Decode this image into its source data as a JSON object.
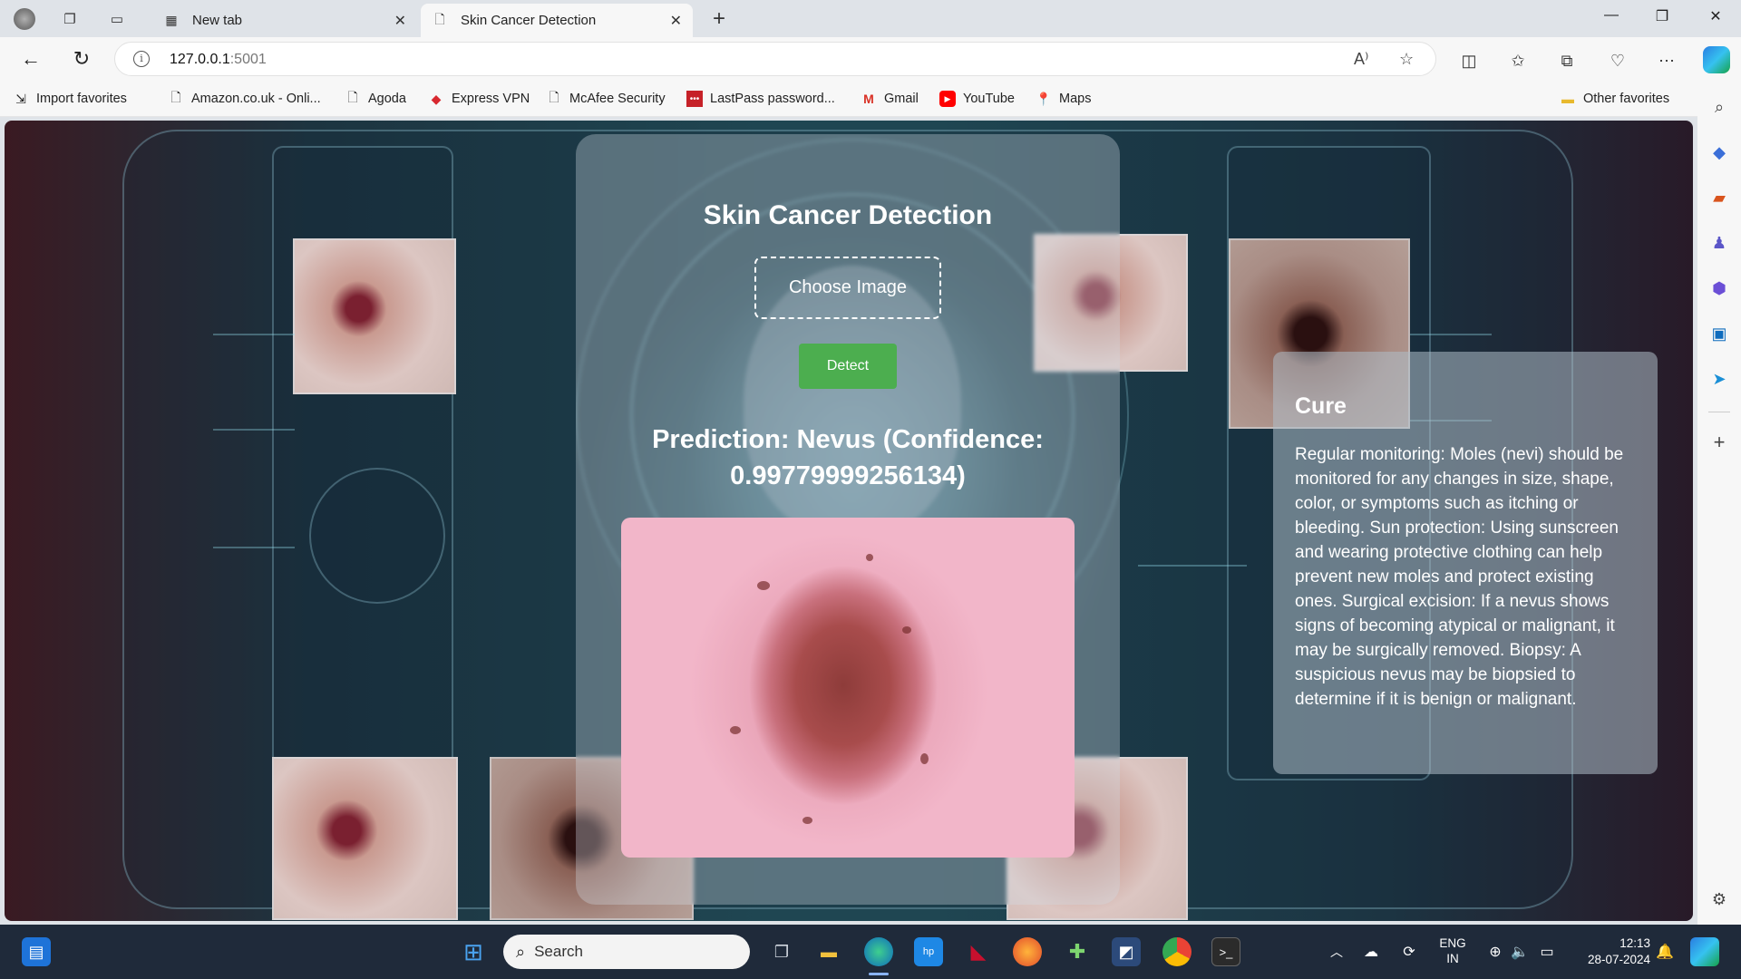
{
  "browser": {
    "tabs": [
      {
        "label": "New tab",
        "active": false
      },
      {
        "label": "Skin Cancer Detection",
        "active": true
      }
    ],
    "url_host": "127.0.0.1",
    "url_port": ":5001",
    "favorites": [
      {
        "label": "Import favorites",
        "icon": "import-icon"
      },
      {
        "label": "Amazon.co.uk - Onli...",
        "icon": "page-icon"
      },
      {
        "label": "Agoda",
        "icon": "page-icon"
      },
      {
        "label": "Express VPN",
        "icon": "expressvpn-icon"
      },
      {
        "label": "McAfee Security",
        "icon": "page-icon"
      },
      {
        "label": "LastPass password...",
        "icon": "lastpass-icon"
      },
      {
        "label": "Gmail",
        "icon": "gmail-icon"
      },
      {
        "label": "YouTube",
        "icon": "youtube-icon"
      },
      {
        "label": "Maps",
        "icon": "maps-icon"
      }
    ],
    "other_favorites": "Other favorites"
  },
  "page": {
    "title": "Skin Cancer Detection",
    "choose_label": "Choose Image",
    "detect_label": "Detect",
    "prediction_line1": "Prediction: Nevus (Confidence:",
    "prediction_line2": "0.99779999256134)",
    "cure": {
      "heading": "Cure",
      "body": "Regular monitoring: Moles (nevi) should be monitored for any changes in size, shape, color, or symptoms such as itching or bleeding. Sun protection: Using sunscreen and wearing protective clothing can help prevent new moles and protect existing ones. Surgical excision: If a nevus shows signs of becoming atypical or malignant, it may be surgically removed. Biopsy: A suspicious nevus may be biopsied to determine if it is benign or malignant."
    }
  },
  "taskbar": {
    "search_label": "Search",
    "lang_line1": "ENG",
    "lang_line2": "IN",
    "time": "12:13",
    "date": "28-07-2024"
  },
  "colors": {
    "detect_button": "#4cae4f",
    "tab_bar": "#dfe3e8",
    "taskbar": "#1f2a3a"
  }
}
